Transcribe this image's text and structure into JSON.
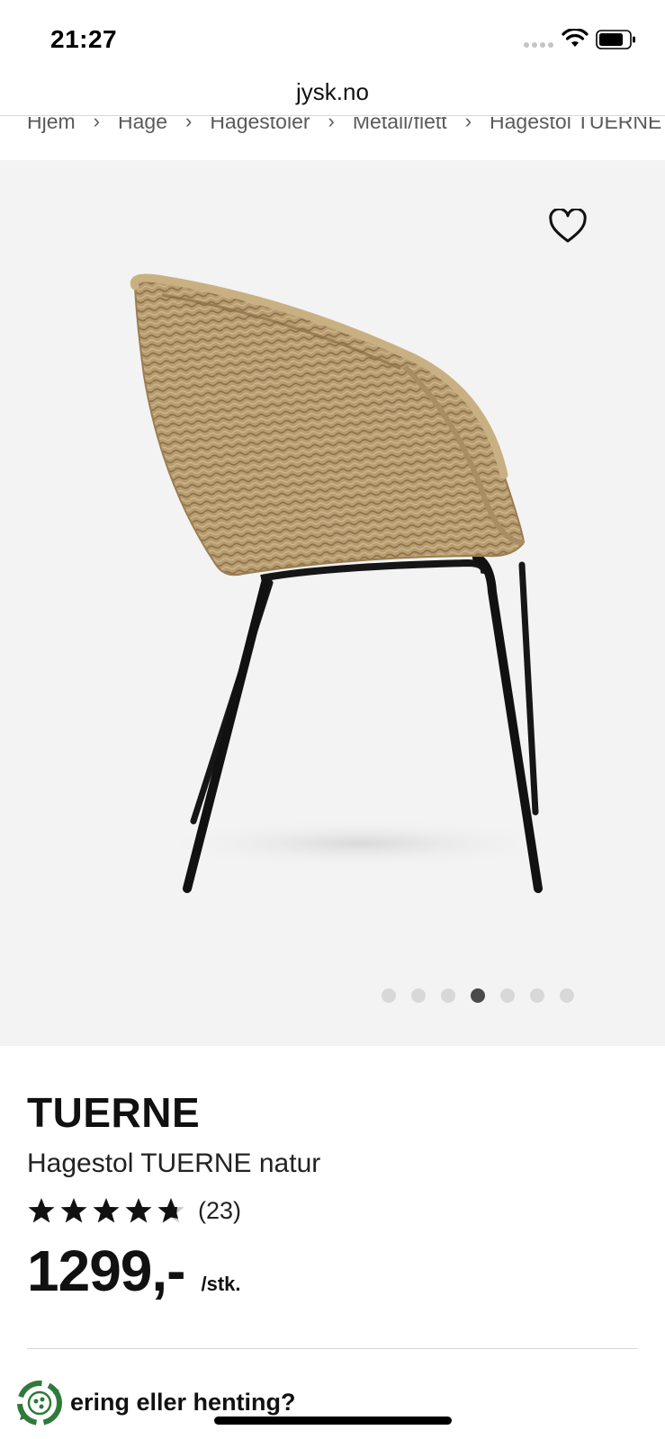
{
  "status_bar": {
    "time": "21:27",
    "signal_icon": "signal-dots-icon",
    "wifi_icon": "wifi-icon",
    "battery_icon": "battery-icon"
  },
  "browser": {
    "url": "jysk.no"
  },
  "breadcrumb": {
    "items": [
      "Hjem",
      "Hage",
      "Hagestoler",
      "Metall/flett",
      "Hagestol TUERNE"
    ],
    "separator": "›"
  },
  "gallery": {
    "favorite_icon": "heart-icon",
    "image_alt": "Hagestol TUERNE natur",
    "slide_count": 7,
    "active_slide": 4
  },
  "product": {
    "brand": "TUERNE",
    "name": "Hagestol TUERNE natur",
    "rating": 4.5,
    "rating_max": 5,
    "review_count": "(23)",
    "price": "1299,-",
    "unit": "/stk."
  },
  "delivery": {
    "icon": "recycle-icon",
    "question": "ering eller henting?"
  },
  "colors": {
    "gallery_bg": "#f3f3f3",
    "active_dot": "#4a4a4a",
    "inactive_dot": "#d8d8d8",
    "wicker": "#b59a6e",
    "legs": "#111111",
    "recycle_green": "#2f7a3a"
  }
}
